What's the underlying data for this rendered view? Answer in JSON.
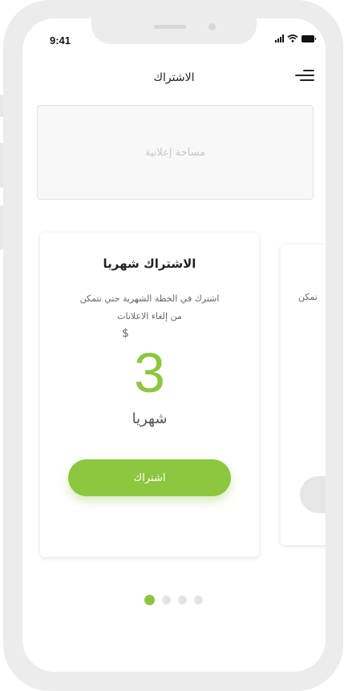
{
  "status_bar": {
    "time": "9:41"
  },
  "header": {
    "title": "الاشتراك"
  },
  "ad": {
    "label": "مساحة إعلانية"
  },
  "plans": [
    {
      "title": "الاشتراك شهريا",
      "description_line1": "اشترك في الخطة الشهرية حتي تتمكن",
      "description_line2": "من إلغاء الاعلانات",
      "currency": "$",
      "price": "3",
      "period": "شهريا",
      "button_label": "اشتراك"
    },
    {
      "description_partial": "تمكن"
    }
  ],
  "pagination": {
    "total": 4,
    "active": 0
  },
  "colors": {
    "accent": "#8dc63f",
    "frame": "#ececec"
  }
}
